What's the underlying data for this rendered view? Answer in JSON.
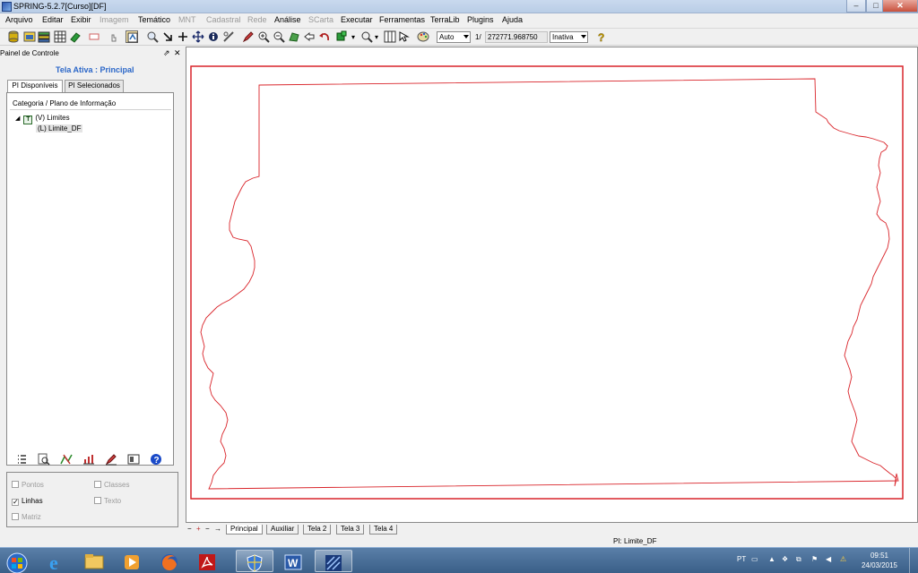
{
  "window": {
    "title": "SPRING-5.2.7[Curso][DF]",
    "minimize": "–",
    "maximize": "□",
    "close": "✕"
  },
  "menu": [
    {
      "label": "Arquivo",
      "enabled": true
    },
    {
      "label": "Editar",
      "enabled": true
    },
    {
      "label": "Exibir",
      "enabled": true
    },
    {
      "label": "Imagem",
      "enabled": false
    },
    {
      "label": "Temático",
      "enabled": true
    },
    {
      "label": "MNT",
      "enabled": false
    },
    {
      "label": "Cadastral",
      "enabled": false
    },
    {
      "label": "Rede",
      "enabled": false
    },
    {
      "label": "Análise",
      "enabled": true
    },
    {
      "label": "SCarta",
      "enabled": false
    },
    {
      "label": "Executar",
      "enabled": true
    },
    {
      "label": "Ferramentas",
      "enabled": true
    },
    {
      "label": "TerraLib",
      "enabled": true
    },
    {
      "label": "Plugins",
      "enabled": true
    },
    {
      "label": "Ajuda",
      "enabled": true
    }
  ],
  "toolbar": {
    "scale_mode": "Auto",
    "scale_prefix": "1/",
    "scale_value": "272771.968750",
    "status_combo": "Inativa",
    "icons": [
      "database-icon",
      "project-icon",
      "layers-icon",
      "grid-icon",
      "eraser-icon",
      "frame-icon",
      "hand-icon",
      "draw-icon",
      "zoom-icon",
      "arrow-icon",
      "plus-icon",
      "pan-icon",
      "info-icon",
      "measure-icon",
      "pencil-icon",
      "zoom-in-icon",
      "zoom-out-icon",
      "zoom-area-icon",
      "back-icon",
      "undo-icon",
      "select-icon",
      "search-icon",
      "table-icon",
      "pointer-icon",
      "palette-icon",
      "help-icon"
    ]
  },
  "panel": {
    "title": "Painel de Controle",
    "pin": "⇗",
    "close": "✕",
    "active_screen": "Tela Ativa : Principal",
    "tabs": [
      "PI Disponíveis",
      "PI Selecionados"
    ],
    "tree_header": "Categoria / Plano de Informação",
    "tree": [
      {
        "label": "(V) Limites",
        "badge": "T",
        "expanded": true
      },
      {
        "label": "(L) Limite_DF",
        "selected": true
      }
    ],
    "tools": [
      "list-icon",
      "zoom-doc-icon",
      "edit-map-icon",
      "chart-icon",
      "pencil-icon",
      "frame-icon",
      "help-icon"
    ],
    "checkboxes": [
      {
        "label": "Pontos",
        "checked": false,
        "enabled": false
      },
      {
        "label": "Classes",
        "checked": false,
        "enabled": false
      },
      {
        "label": "Linhas",
        "checked": true,
        "enabled": true
      },
      {
        "label": "Texto",
        "checked": false,
        "enabled": false
      },
      {
        "label": "Matriz",
        "checked": false,
        "enabled": false
      }
    ]
  },
  "canvas": {
    "boundary_color": "#d9242a",
    "frame_color": "#d9242a"
  },
  "screen_tabs": {
    "nav": [
      "−",
      "+",
      "−",
      "→"
    ],
    "tabs": [
      "Principal",
      "Auxiliar",
      "Tela 2",
      "Tela 3",
      "Tela 4"
    ],
    "selected": "Principal"
  },
  "status": {
    "pi": "PI: Limite_DF"
  },
  "taskbar": {
    "apps": [
      "start-orb-icon",
      "internet-explorer-icon",
      "file-explorer-icon",
      "media-player-icon",
      "firefox-icon",
      "acrobat-icon",
      "security-shield-icon",
      "word-icon",
      "spring-app-icon"
    ],
    "language": "PT",
    "time": "09:51",
    "date": "24/03/2015"
  }
}
